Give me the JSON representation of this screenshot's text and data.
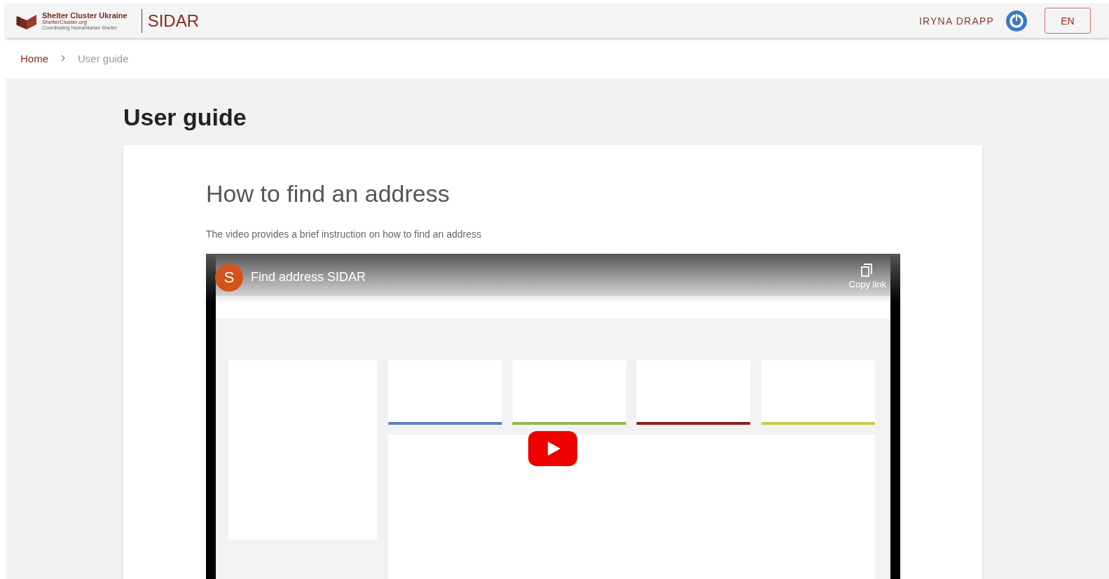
{
  "header": {
    "logo": {
      "name": "Shelter Cluster Ukraine",
      "site": "ShelterCluster.org",
      "tagline": "Coordinating Humanitarian Shelter"
    },
    "app_name": "SIDAR",
    "user": "IRYNA DRAPP",
    "language": "EN"
  },
  "breadcrumb": [
    {
      "label": "Home",
      "kind": "link"
    },
    {
      "label": "User guide",
      "kind": "current"
    }
  ],
  "page_title": "User guide",
  "section": {
    "title": "How to find an address",
    "description": "The video provides a brief instruction on how to find an address",
    "video": {
      "channel_initial": "S",
      "title": "Find address SIDAR",
      "copy_label": "Copy link"
    }
  }
}
